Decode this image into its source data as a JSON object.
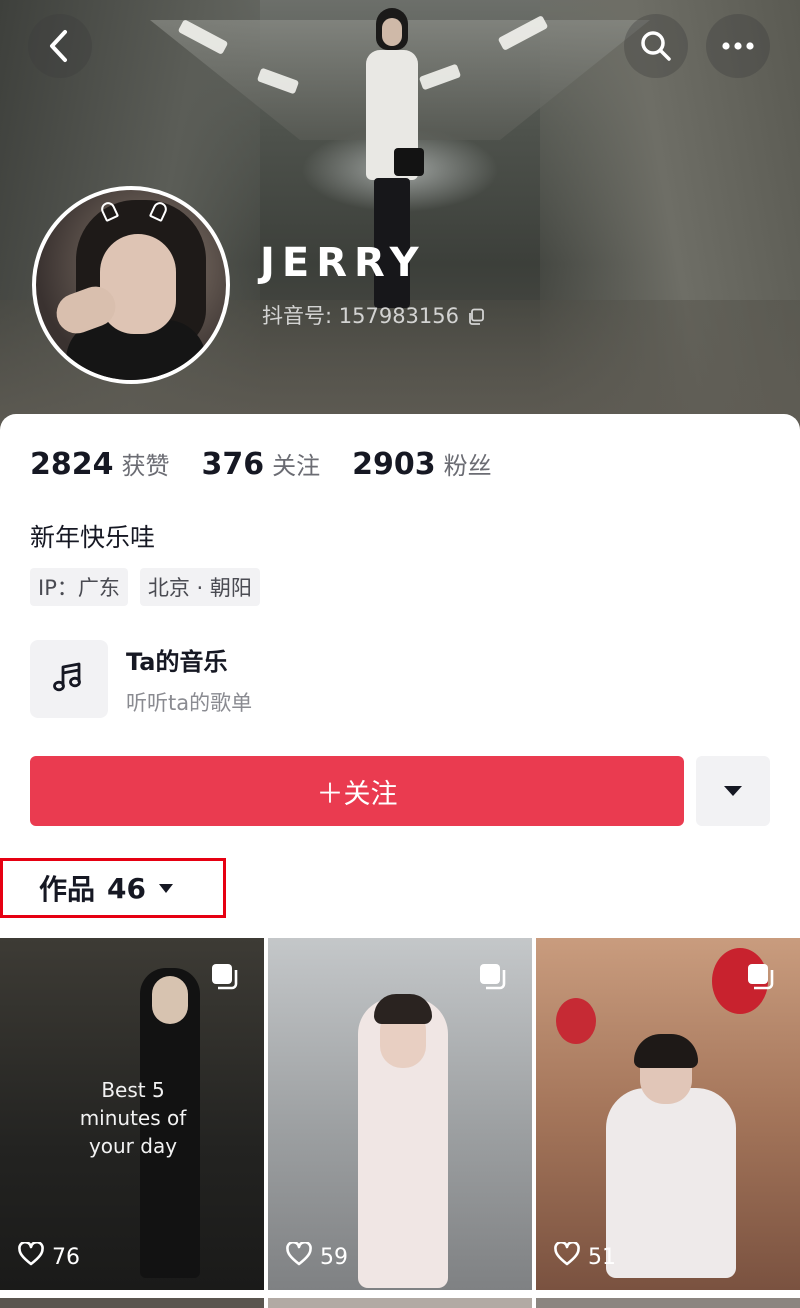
{
  "header": {
    "username": "JERRY",
    "douyin_id": "抖音号: 157983156",
    "back_icon": "chevron-left-icon",
    "search_icon": "search-icon",
    "more_icon": "more-horizontal-icon"
  },
  "stats": [
    {
      "value": "2824",
      "label": "获赞"
    },
    {
      "value": "376",
      "label": "关注"
    },
    {
      "value": "2903",
      "label": "粉丝"
    }
  ],
  "bio": "新年快乐哇",
  "tags": [
    "IP：广东",
    "北京 · 朝阳"
  ],
  "music": {
    "title": "Ta的音乐",
    "subtitle": "听听ta的歌单",
    "icon": "music-note-icon"
  },
  "actions": {
    "follow_label": "＋关注",
    "more_icon": "caret-down-icon"
  },
  "works_tab": {
    "label": "作品",
    "count": "46",
    "icon": "caret-down-icon"
  },
  "grid": [
    {
      "likes": "76",
      "overlay_text": "Best 5 minutes of your day",
      "bg": "#2b2b2a"
    },
    {
      "likes": "59",
      "overlay_text": "",
      "bg": "#9fa3a6"
    },
    {
      "likes": "51",
      "overlay_text": "",
      "bg": "#9c7058"
    }
  ],
  "colors": {
    "accent": "#ea3b50",
    "highlight_box": "#e60012"
  }
}
